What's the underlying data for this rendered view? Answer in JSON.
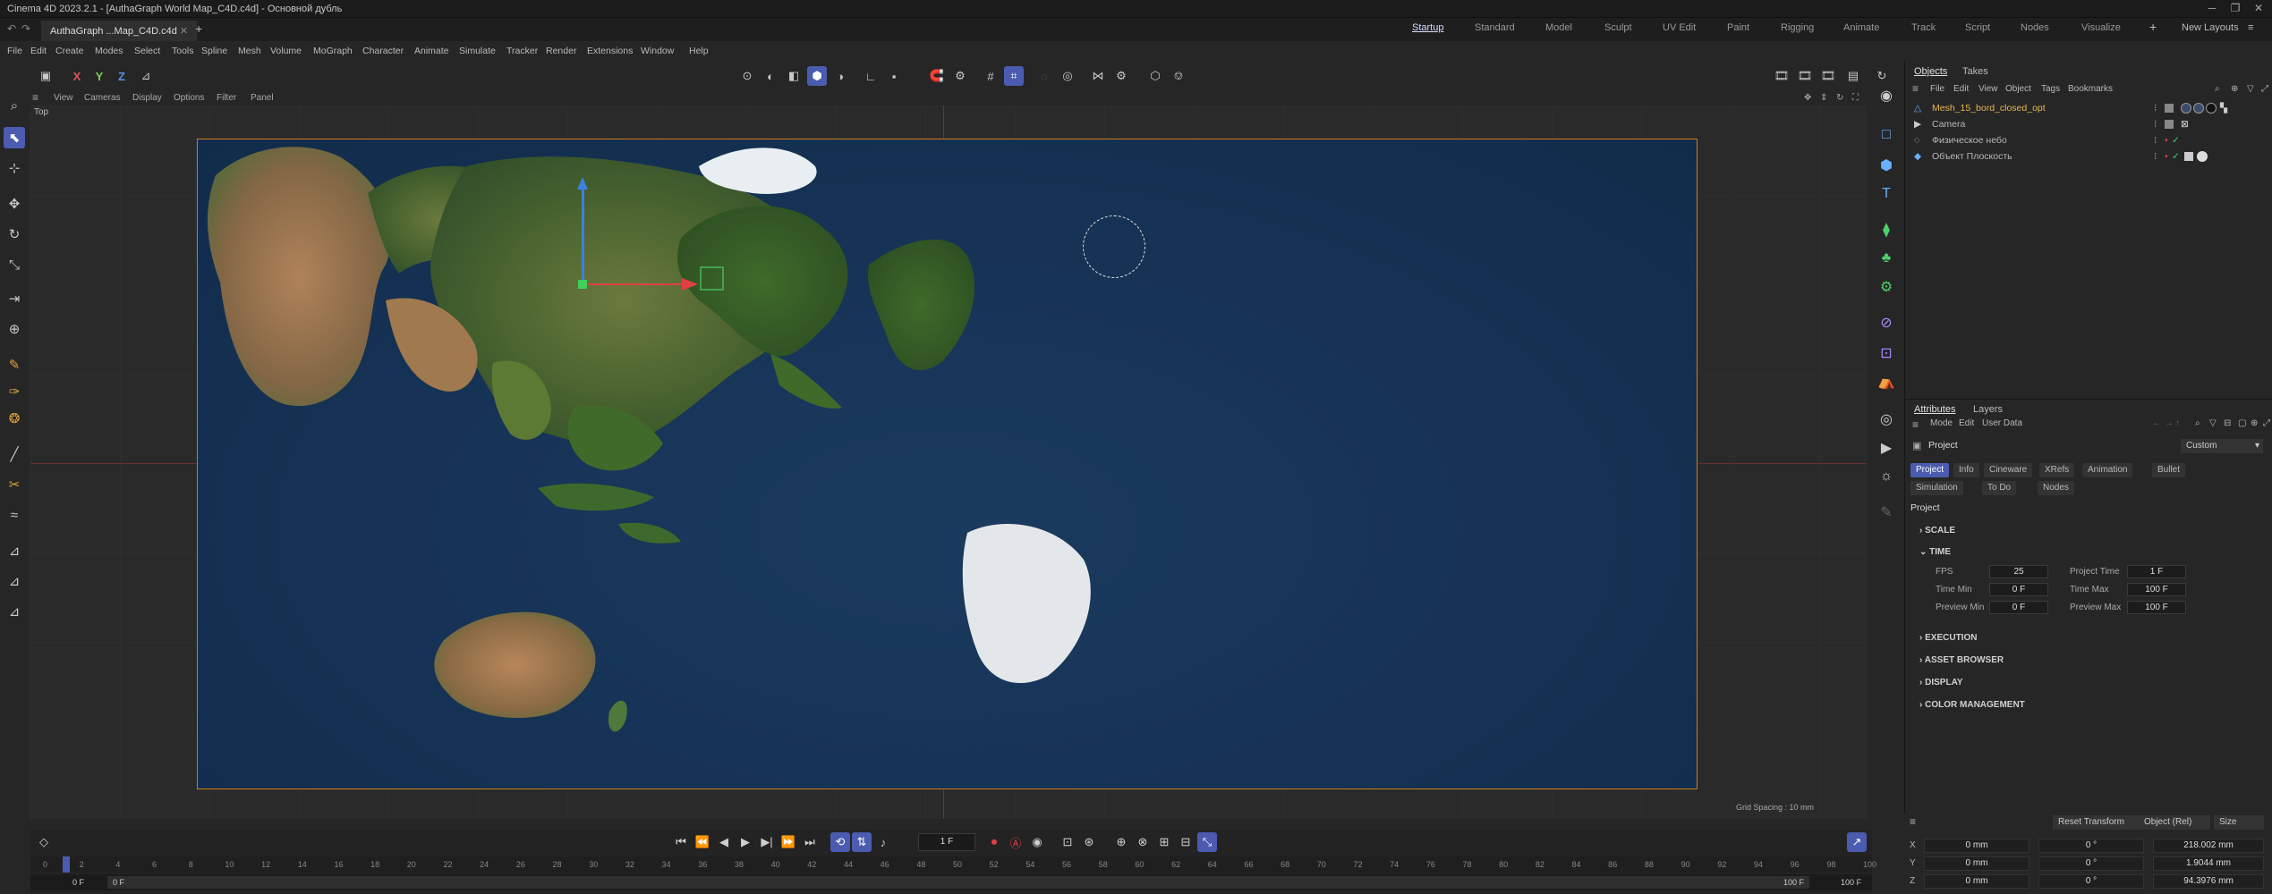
{
  "window": {
    "title": "Cinema 4D 2023.2.1 - [AuthaGraph World Map_C4D.c4d] - Основной дубль"
  },
  "file_tab": {
    "label": "AuthaGraph ...Map_C4D.c4d"
  },
  "layouts": [
    {
      "label": "Startup",
      "active": true
    },
    {
      "label": "Standard"
    },
    {
      "label": "Model"
    },
    {
      "label": "Sculpt"
    },
    {
      "label": "UV Edit"
    },
    {
      "label": "Paint"
    },
    {
      "label": "Rigging"
    },
    {
      "label": "Animate"
    },
    {
      "label": "Track"
    },
    {
      "label": "Script"
    },
    {
      "label": "Nodes"
    },
    {
      "label": "Visualize"
    }
  ],
  "new_layouts": "New Layouts",
  "menu": [
    "File",
    "Edit",
    "Create",
    "Modes",
    "Select",
    "Tools",
    "Spline",
    "Mesh",
    "Volume",
    "MoGraph",
    "Character",
    "Animate",
    "Simulate",
    "Tracker",
    "Render",
    "Extensions",
    "Window",
    "Help"
  ],
  "axes_toolbar": {
    "x": "X",
    "y": "Y",
    "z": "Z"
  },
  "viewport": {
    "menu": [
      "View",
      "Cameras",
      "Display",
      "Options",
      "Filter",
      "Panel"
    ],
    "view_name": "Top",
    "grid_spacing": "Grid Spacing : 10 mm"
  },
  "objects_panel": {
    "tabs": [
      "Objects",
      "Takes"
    ],
    "menu": [
      "File",
      "Edit",
      "View",
      "Object",
      "Tags",
      "Bookmarks"
    ],
    "objects": [
      {
        "name": "Mesh_15_bord_closed_opt",
        "color": "#e8b84a"
      },
      {
        "name": "Camera",
        "color": "#c8c8c8"
      },
      {
        "name": "Физическое небо",
        "color": "#c8c8c8"
      },
      {
        "name": "Объект Плоскость",
        "color": "#c8c8c8"
      }
    ]
  },
  "attributes_panel": {
    "tabs": [
      "Attributes",
      "Layers"
    ],
    "menu": [
      "Mode",
      "Edit",
      "User Data"
    ],
    "header": "Project",
    "preset": "Custom",
    "buttons_row1": [
      "Project",
      "Info",
      "Cineware",
      "XRefs",
      "Animation",
      "Bullet"
    ],
    "buttons_row2": [
      "Simulation",
      "To Do",
      "Nodes"
    ],
    "section_title": "Project",
    "sections": {
      "scale": "SCALE",
      "time": "TIME",
      "execution": "EXECUTION",
      "asset_browser": "ASSET BROWSER",
      "display": "DISPLAY",
      "color_management": "COLOR MANAGEMENT"
    },
    "time_fields": [
      {
        "label": "FPS",
        "value": "25"
      },
      {
        "label": "Project Time",
        "value": "1 F"
      },
      {
        "label": "Time Min",
        "value": "0 F"
      },
      {
        "label": "Time Max",
        "value": "100 F"
      },
      {
        "label": "Preview Min",
        "value": "0 F"
      },
      {
        "label": "Preview Max",
        "value": "100 F"
      }
    ]
  },
  "coordinates": {
    "reset_transform": "Reset Transform",
    "mode": "Object (Rel)",
    "size_mode": "Size",
    "rows": [
      {
        "axis": "X",
        "pos": "0 mm",
        "rot": "0 °",
        "size": "218.002 mm"
      },
      {
        "axis": "Y",
        "pos": "0 mm",
        "rot": "0 °",
        "size": "1.9044 mm"
      },
      {
        "axis": "Z",
        "pos": "0 mm",
        "rot": "0 °",
        "size": "94.3976 mm"
      }
    ]
  },
  "timeline": {
    "current_frame": "1 F",
    "ticks": [
      "0",
      "2",
      "4",
      "6",
      "8",
      "10",
      "12",
      "14",
      "16",
      "18",
      "20",
      "22",
      "24",
      "26",
      "28",
      "30",
      "32",
      "34",
      "36",
      "38",
      "40",
      "42",
      "44",
      "46",
      "48",
      "50",
      "52",
      "54",
      "56",
      "58",
      "60",
      "62",
      "64",
      "66",
      "68",
      "70",
      "72",
      "74",
      "76",
      "78",
      "80",
      "82",
      "84",
      "86",
      "88",
      "90",
      "92",
      "94",
      "96",
      "98",
      "100"
    ],
    "start_a": "0 F",
    "start_b": "0 F",
    "end_a": "100 F",
    "end_b": "100 F"
  }
}
